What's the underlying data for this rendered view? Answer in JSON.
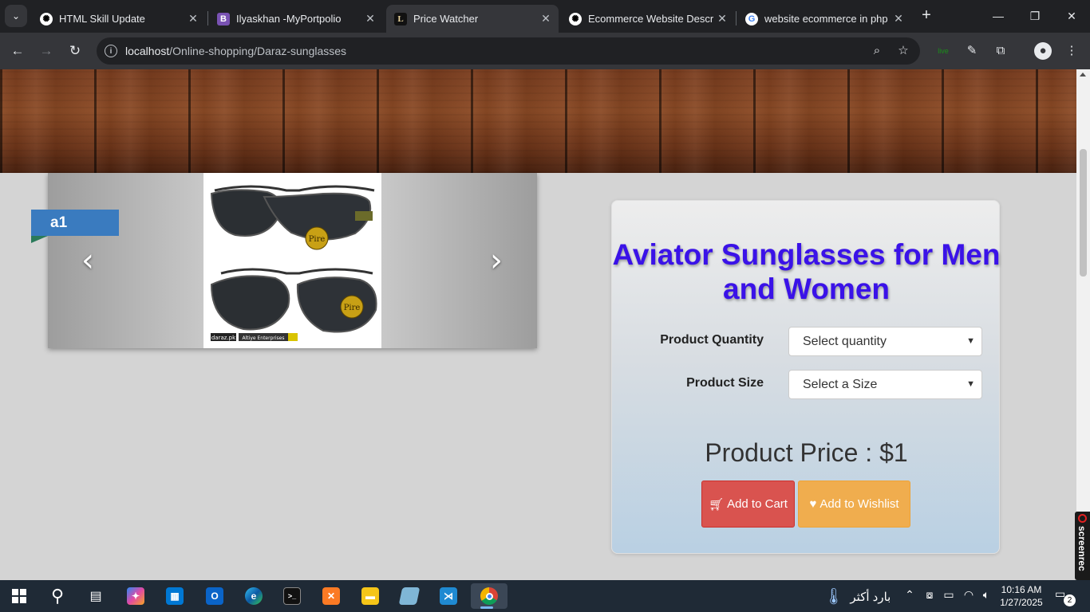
{
  "browser": {
    "tabs": [
      {
        "title": "HTML Skill Update",
        "favicon": "openai-icon",
        "active": false
      },
      {
        "title": "Ilyaskhan -MyPortpolio",
        "favicon": "bootstrap-icon",
        "active": false
      },
      {
        "title": "Price Watcher",
        "favicon": "L",
        "active": true
      },
      {
        "title": "Ecommerce Website Descrip",
        "favicon": "openai-icon",
        "active": false
      },
      {
        "title": "website ecommerce in php a",
        "favicon": "google-icon",
        "active": false
      }
    ],
    "bootstrap_glyph": "B",
    "price_watcher_glyph": "L",
    "url_host": "localhost",
    "url_path": "/Online-shopping/Daraz-sunglasses"
  },
  "carousel": {
    "badge": "a1",
    "prev_glyph": "‹",
    "next_glyph": "›",
    "image_brand_text": "daraz.pk",
    "image_store_text": "Altiye Enterprises"
  },
  "product": {
    "title": "Aviator Sunglasses for Men and Women",
    "quantity_label": "Product Quantity",
    "quantity_placeholder": "Select quantity",
    "size_label": "Product Size",
    "size_placeholder": "Select a Size",
    "price_text": "Product Price : $1",
    "add_to_cart": "Add to Cart",
    "add_to_wishlist": "Add to Wishlist"
  },
  "overlay": {
    "screenrec_label": "screenrec"
  },
  "taskbar": {
    "weather_text": "بارد أكثر",
    "time": "10:16 AM",
    "date": "1/27/2025",
    "notification_count": "2"
  },
  "colors": {
    "title_blue": "#3a12e8",
    "cart_red": "#d9534f",
    "wishlist_orange": "#f0ad4e",
    "ribbon_blue": "#3a7bbf"
  }
}
